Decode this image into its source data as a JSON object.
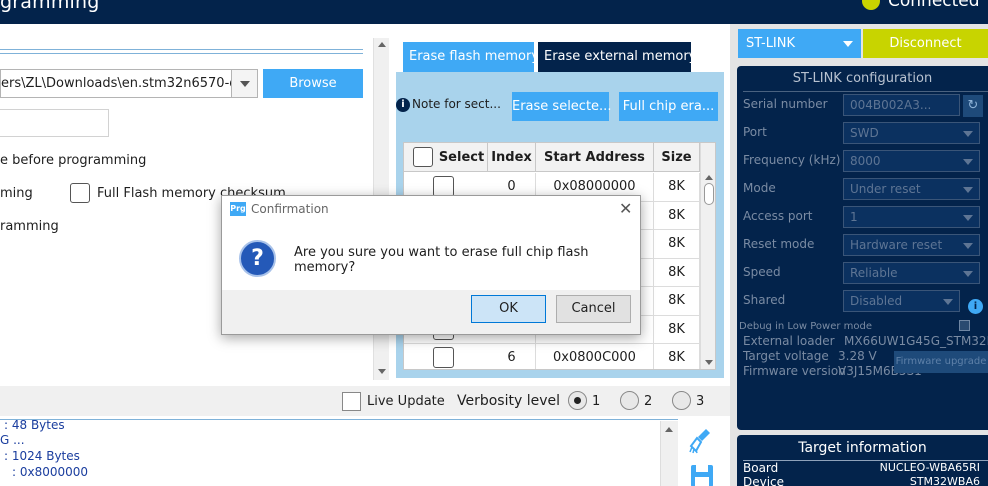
{
  "header": {
    "title": "gramming",
    "connection_status": "Connected"
  },
  "left_panel": {
    "file_path": "ers\\ZL\\Downloads\\en.stm32n6570-dk-",
    "browse_label": "Browse",
    "verify_before_programming": "e before programming",
    "line2_text": "ming",
    "full_checksum_label": "Full Flash memory checksum",
    "line3_text": "ramming"
  },
  "erase": {
    "tabs": [
      {
        "label": "Erase flash memory",
        "active": true
      },
      {
        "label": "Erase external memory",
        "active": false
      }
    ],
    "note_label": "Note for sect...",
    "erase_selected_label": "Erase selecte...",
    "full_chip_label": "Full chip era...",
    "columns": [
      "Select",
      "Index",
      "Start Address",
      "Size"
    ],
    "rows": [
      {
        "index": "0",
        "address": "0x08000000",
        "size": "8K"
      },
      {
        "index": "",
        "address": "",
        "size": "8K"
      },
      {
        "index": "",
        "address": "",
        "size": "8K"
      },
      {
        "index": "",
        "address": "",
        "size": "8K"
      },
      {
        "index": "",
        "address": "",
        "size": "8K"
      },
      {
        "index": "",
        "address": "",
        "size": "8K"
      },
      {
        "index": "6",
        "address": "0x0800C000",
        "size": "8K"
      }
    ]
  },
  "bottom": {
    "live_update_label": "Live Update",
    "verbosity_label": "Verbosity level",
    "levels": [
      "1",
      "2",
      "3"
    ],
    "selected_level": "1"
  },
  "log": {
    "lines": [
      ": 48 Bytes",
      "G ...",
      ": 1024 Bytes",
      ": 0x8000000"
    ]
  },
  "right_panel": {
    "probe_select": "ST-LINK",
    "disconnect_label": "Disconnect",
    "config_title": "ST-LINK configuration",
    "fields": [
      {
        "label": "Serial number",
        "value": "004B002A3..."
      },
      {
        "label": "Port",
        "value": "SWD"
      },
      {
        "label": "Frequency (kHz)",
        "value": "8000"
      },
      {
        "label": "Mode",
        "value": "Under reset"
      },
      {
        "label": "Access port",
        "value": "1"
      },
      {
        "label": "Reset mode",
        "value": "Hardware reset"
      },
      {
        "label": "Speed",
        "value": "Reliable"
      },
      {
        "label": "Shared",
        "value": "Disabled"
      }
    ],
    "debug_low_power": "Debug in Low Power mode",
    "external_loader_label": "External loader",
    "external_loader_value": "MX66UW1G45G_STM32N...",
    "target_voltage_label": "Target voltage",
    "target_voltage_value": "3.28 V",
    "firmware_version_label": "Firmware version",
    "firmware_version_value": "V3J15M6B5S1",
    "firmware_upgrade_label": "Firmware upgrade",
    "target_title": "Target information",
    "board_label": "Board",
    "board_value": "NUCLEO-WBA65RI",
    "device_label": "Device",
    "device_value": "STM32WBA6"
  },
  "dialog": {
    "title": "Confirmation",
    "app_icon": "Prg",
    "message": "Are you sure you want to erase full chip flash memory?",
    "ok_label": "OK",
    "cancel_label": "Cancel"
  },
  "colors": {
    "navy": "#03234b",
    "accent_blue": "#3fa9f5",
    "lime": "#c8d400",
    "erase_panel_bg": "#a9d3ec"
  }
}
